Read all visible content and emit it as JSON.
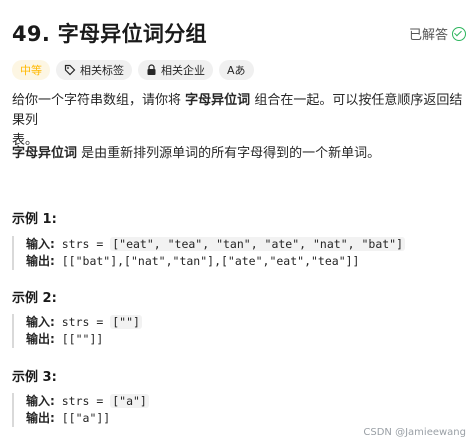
{
  "title": "49. 字母异位词分组",
  "status": "已解答",
  "tags": {
    "difficulty": "中等",
    "topics": "相关标签",
    "companies": "相关企业",
    "font_size": "Aあ"
  },
  "description": {
    "p1_a": "给你一个字符串数组，请你将",
    "p1_bold": "字母异位词",
    "p1_b": "组合在一起。可以按任意顺序返回结果列",
    "p1_c": "表。",
    "p2_bold": "字母异位词",
    "p2_rest": "是由重新排列源单词的所有字母得到的一个新单词。"
  },
  "examples": [
    {
      "title": "示例 1:",
      "input_label": "输入:",
      "input_var": "strs = ",
      "input_value": "[\"eat\", \"tea\", \"tan\", \"ate\", \"nat\", \"bat\"]",
      "output_label": "输出:",
      "output_value": "[[\"bat\"],[\"nat\",\"tan\"],[\"ate\",\"eat\",\"tea\"]]"
    },
    {
      "title": "示例 2:",
      "input_label": "输入:",
      "input_var": "strs = ",
      "input_value": "[\"\"]",
      "output_label": "输出:",
      "output_value": "[[\"\"]]"
    },
    {
      "title": "示例 3:",
      "input_label": "输入:",
      "input_var": "strs = ",
      "input_value": "[\"a\"]",
      "output_label": "输出:",
      "output_value": "[[\"a\"]]"
    }
  ],
  "watermark": "CSDN @Jamieewang"
}
